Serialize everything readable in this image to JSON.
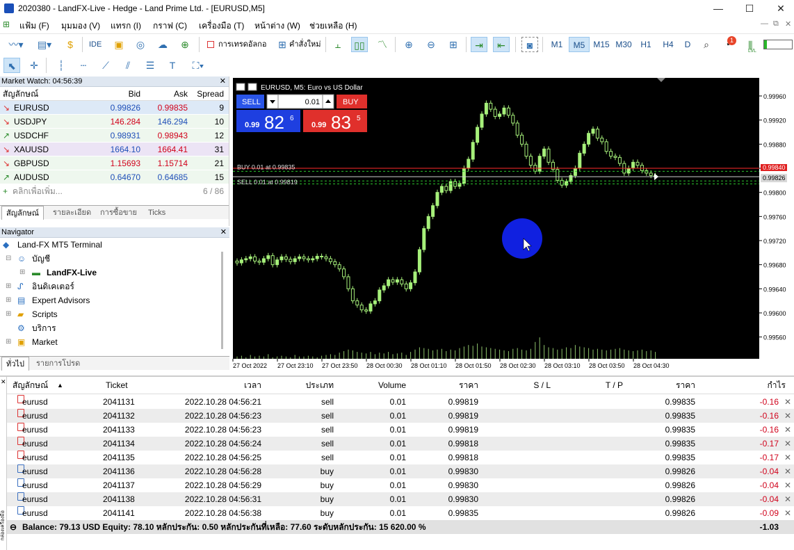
{
  "window": {
    "title": "2020380 - LandFX-Live - Hedge - Land Prime Ltd. - [EURUSD,M5]",
    "minimize": "—",
    "maximize": "☐",
    "close": "✕"
  },
  "menu": [
    "แฟ้ม (F)",
    "มุมมอง (V)",
    "แทรก (I)",
    "กราฟ (C)",
    "เครื่องมือ (T)",
    "หน้าต่าง (W)",
    "ช่วยเหลือ (H)"
  ],
  "mdi_controls": [
    "—",
    "⧉",
    "✕"
  ],
  "toolbar": {
    "ide": "IDE",
    "algo_label": "การเทรดอัลกอ",
    "new_order_label": "คำสั่งใหม่",
    "timeframes": [
      "M1",
      "M5",
      "M15",
      "M30",
      "H1",
      "H4",
      "D"
    ],
    "active_timeframe": "M5",
    "notification_count": "1",
    "lvl": "LVL"
  },
  "market_watch": {
    "title": "Market Watch: 04:56:39",
    "columns": [
      "สัญลักษณ์",
      "Bid",
      "Ask",
      "Spread"
    ],
    "rows": [
      {
        "symbol": "EURUSD",
        "bid": "0.99826",
        "ask": "0.99835",
        "spread": "9",
        "dir": "down",
        "bid_color": "#1f4fb8",
        "ask_color": "#d0021b"
      },
      {
        "symbol": "USDJPY",
        "bid": "146.284",
        "ask": "146.294",
        "spread": "10",
        "dir": "down",
        "bid_color": "#d0021b",
        "ask_color": "#1f4fb8"
      },
      {
        "symbol": "USDCHF",
        "bid": "0.98931",
        "ask": "0.98943",
        "spread": "12",
        "dir": "up",
        "bid_color": "#1f4fb8",
        "ask_color": "#d0021b"
      },
      {
        "symbol": "XAUUSD",
        "bid": "1664.10",
        "ask": "1664.41",
        "spread": "31",
        "dir": "down",
        "bid_color": "#1f4fb8",
        "ask_color": "#d0021b"
      },
      {
        "symbol": "GBPUSD",
        "bid": "1.15693",
        "ask": "1.15714",
        "spread": "21",
        "dir": "down",
        "bid_color": "#d0021b",
        "ask_color": "#d0021b"
      },
      {
        "symbol": "AUDUSD",
        "bid": "0.64670",
        "ask": "0.64685",
        "spread": "15",
        "dir": "up",
        "bid_color": "#1f4fb8",
        "ask_color": "#1f4fb8"
      }
    ],
    "add_label": "คลิกเพื่อเพิ่ม...",
    "count": "6 / 86",
    "tabs": [
      "สัญลักษณ์",
      "รายละเอียด",
      "การซื้อขาย",
      "Ticks"
    ]
  },
  "navigator": {
    "title": "Navigator",
    "items": [
      "Land-FX MT5 Terminal",
      "บัญชี",
      "LandFX-Live",
      "อินดิเคเตอร์",
      "Expert Advisors",
      "Scripts",
      "บริการ",
      "Market"
    ],
    "tabs": [
      "ทั่วไป",
      "รายการโปรด"
    ]
  },
  "chart": {
    "header": "EURUSD, M5:  Euro vs US Dollar",
    "sell_label": "SELL",
    "buy_label": "BUY",
    "lot": "0.01",
    "sell_price_small": "0.99",
    "sell_price_big": "82",
    "sell_price_sup": "6",
    "buy_price_small": "0.99",
    "buy_price_big": "83",
    "buy_price_sup": "5",
    "buy_line_label": "BUY 0.01 at 0.99835",
    "sell_line_label": "SELL 0.01 at 0.99819",
    "bid_box": "0.99826",
    "ask_box": "0.99840",
    "colors": {
      "bg": "#000000",
      "candle": "#a6f07a",
      "bid_line": "#d0d0d0",
      "ask_line": "#ff2a2a",
      "order_line": "#2cc52c",
      "sell_btn": "#1e3fe0",
      "buy_btn": "#e0302c",
      "cursor_dot": "#1020e0"
    }
  },
  "chart_data": {
    "type": "candlestick",
    "symbol": "EURUSD",
    "timeframe": "M5",
    "y_ticks": [
      "0.99960",
      "0.99920",
      "0.99880",
      "0.99840",
      "0.99800",
      "0.99760",
      "0.99720",
      "0.99680",
      "0.99640",
      "0.99600",
      "0.99560"
    ],
    "x_ticks": [
      "27 Oct 2022",
      "27 Oct 23:10",
      "27 Oct 23:50",
      "28 Oct 00:30",
      "28 Oct 01:10",
      "28 Oct 01:50",
      "28 Oct 02:30",
      "28 Oct 03:10",
      "28 Oct 03:50",
      "28 Oct 04:30"
    ],
    "ylim": [
      0.9954,
      0.9999
    ],
    "closes": [
      0.99683,
      0.99688,
      0.9969,
      0.99693,
      0.99686,
      0.99684,
      0.9969,
      0.99695,
      0.9968,
      0.99688,
      0.99693,
      0.99689,
      0.99685,
      0.9969,
      0.99693,
      0.9969,
      0.99688,
      0.9969,
      0.99694,
      0.99693,
      0.9969,
      0.99685,
      0.9968,
      0.99673,
      0.9966,
      0.9964,
      0.9962,
      0.99613,
      0.99605,
      0.99603,
      0.99615,
      0.9962,
      0.99638,
      0.99645,
      0.99655,
      0.99651,
      0.99655,
      0.99648,
      0.9964,
      0.9965,
      0.99668,
      0.99705,
      0.9974,
      0.9976,
      0.99778,
      0.998,
      0.9981,
      0.99803,
      0.99818,
      0.9981,
      0.99815,
      0.9984,
      0.99855,
      0.99883,
      0.99908,
      0.9993,
      0.99948,
      0.99938,
      0.99926,
      0.9993,
      0.9994,
      0.99928,
      0.99915,
      0.99895,
      0.9988,
      0.9986,
      0.99845,
      0.99835,
      0.9986,
      0.99872,
      0.9985,
      0.99838,
      0.9982,
      0.99812,
      0.99818,
      0.99828,
      0.9984,
      0.99865,
      0.9988,
      0.99898,
      0.99905,
      0.9989,
      0.99884,
      0.99868,
      0.9986,
      0.99858,
      0.99848,
      0.99832,
      0.9984,
      0.9985,
      0.99845,
      0.99836,
      0.99832,
      0.99828,
      0.99826
    ],
    "volumes": [
      3,
      4,
      2,
      5,
      3,
      4,
      3,
      6,
      2,
      3,
      4,
      3,
      2,
      5,
      3,
      3,
      4,
      3,
      2,
      4,
      5,
      6,
      5,
      8,
      10,
      12,
      11,
      9,
      8,
      7,
      9,
      6,
      8,
      7,
      9,
      6,
      7,
      8,
      5,
      9,
      12,
      15,
      14,
      13,
      11,
      12,
      13,
      10,
      12,
      11,
      14,
      16,
      18,
      17,
      20,
      16,
      15,
      14,
      13,
      12,
      11,
      10,
      13,
      14,
      12,
      11,
      13,
      22,
      28,
      18,
      15,
      14,
      12,
      13,
      15,
      14,
      18,
      16,
      15,
      14,
      12,
      13,
      12,
      11,
      12,
      13,
      14,
      12,
      11,
      10,
      11,
      12,
      10,
      11,
      9
    ]
  },
  "trade": {
    "columns": [
      "สัญลักษณ์",
      "Ticket",
      "เวลา",
      "ประเภท",
      "Volume",
      "ราคา",
      "S / L",
      "T / P",
      "ราคา",
      "กำไร"
    ],
    "sort_indicator": "▲",
    "rows": [
      {
        "symbol": "eurusd",
        "ticket": "2041131",
        "time": "2022.10.28 04:56:21",
        "type": "sell",
        "volume": "0.01",
        "price": "0.99819",
        "sl": "",
        "tp": "",
        "current": "0.99835",
        "profit": "-0.16"
      },
      {
        "symbol": "eurusd",
        "ticket": "2041132",
        "time": "2022.10.28 04:56:23",
        "type": "sell",
        "volume": "0.01",
        "price": "0.99819",
        "sl": "",
        "tp": "",
        "current": "0.99835",
        "profit": "-0.16"
      },
      {
        "symbol": "eurusd",
        "ticket": "2041133",
        "time": "2022.10.28 04:56:23",
        "type": "sell",
        "volume": "0.01",
        "price": "0.99819",
        "sl": "",
        "tp": "",
        "current": "0.99835",
        "profit": "-0.16"
      },
      {
        "symbol": "eurusd",
        "ticket": "2041134",
        "time": "2022.10.28 04:56:24",
        "type": "sell",
        "volume": "0.01",
        "price": "0.99818",
        "sl": "",
        "tp": "",
        "current": "0.99835",
        "profit": "-0.17"
      },
      {
        "symbol": "eurusd",
        "ticket": "2041135",
        "time": "2022.10.28 04:56:25",
        "type": "sell",
        "volume": "0.01",
        "price": "0.99818",
        "sl": "",
        "tp": "",
        "current": "0.99835",
        "profit": "-0.17"
      },
      {
        "symbol": "eurusd",
        "ticket": "2041136",
        "time": "2022.10.28 04:56:28",
        "type": "buy",
        "volume": "0.01",
        "price": "0.99830",
        "sl": "",
        "tp": "",
        "current": "0.99826",
        "profit": "-0.04"
      },
      {
        "symbol": "eurusd",
        "ticket": "2041137",
        "time": "2022.10.28 04:56:29",
        "type": "buy",
        "volume": "0.01",
        "price": "0.99830",
        "sl": "",
        "tp": "",
        "current": "0.99826",
        "profit": "-0.04"
      },
      {
        "symbol": "eurusd",
        "ticket": "2041138",
        "time": "2022.10.28 04:56:31",
        "type": "buy",
        "volume": "0.01",
        "price": "0.99830",
        "sl": "",
        "tp": "",
        "current": "0.99826",
        "profit": "-0.04"
      },
      {
        "symbol": "eurusd",
        "ticket": "2041141",
        "time": "2022.10.28 04:56:38",
        "type": "buy",
        "volume": "0.01",
        "price": "0.99835",
        "sl": "",
        "tp": "",
        "current": "0.99826",
        "profit": "-0.09"
      }
    ],
    "balance_line": "Balance: 79.13 USD  Equity: 78.10  หลักประกัน: 0.50  หลักประกันที่เหลือ: 77.60  ระดับหลักประกัน: 15 620.00 %",
    "total_profit": "-1.03",
    "side_label": "กล่องเครื่องมือ"
  }
}
